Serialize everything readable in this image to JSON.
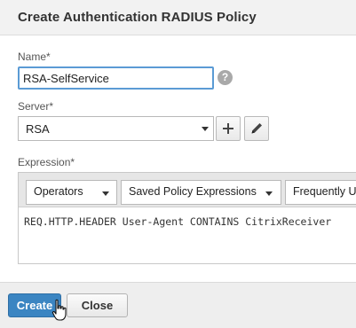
{
  "dialog": {
    "title": "Create Authentication RADIUS Policy"
  },
  "form": {
    "name_label": "Name*",
    "name_value": "RSA-SelfService",
    "help_icon": "question-circle-icon",
    "help_glyph": "?",
    "server_label": "Server*",
    "server_value": "RSA",
    "add_icon": "plus-icon",
    "edit_icon": "pencil-icon",
    "expression_label": "Expression*",
    "expression_toolbar": {
      "operators": "Operators",
      "saved_policy_expressions": "Saved Policy Expressions",
      "frequently_used": "Frequently Use"
    },
    "expression_value": "REQ.HTTP.HEADER User-Agent CONTAINS CitrixReceiver"
  },
  "footer": {
    "create_label": "Create",
    "close_label": "Close",
    "cursor_icon": "hand-pointer-icon"
  },
  "colors": {
    "primary_button": "#3b85c2",
    "focus_border": "#5b9bd5",
    "header_bg": "#f2f2f2"
  }
}
